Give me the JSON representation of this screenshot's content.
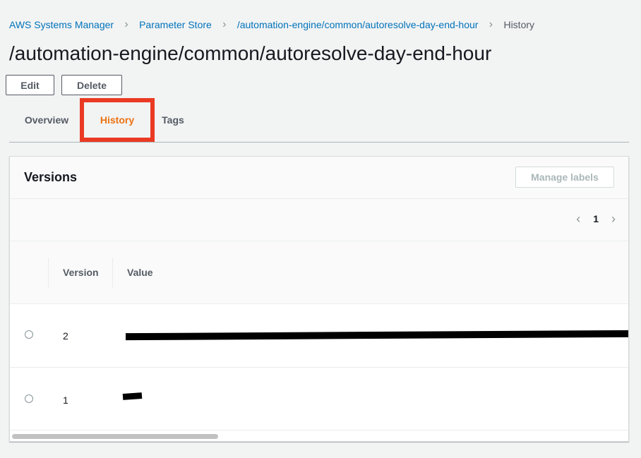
{
  "breadcrumb": {
    "items": [
      {
        "label": "AWS Systems Manager"
      },
      {
        "label": "Parameter Store"
      },
      {
        "label": "/automation-engine/common/autoresolve-day-end-hour"
      }
    ],
    "current": "History"
  },
  "page_title": "/automation-engine/common/autoresolve-day-end-hour",
  "actions": {
    "edit_label": "Edit",
    "delete_label": "Delete"
  },
  "tabs": [
    {
      "label": "Overview",
      "active": false
    },
    {
      "label": "History",
      "active": true
    },
    {
      "label": "Tags",
      "active": false
    }
  ],
  "versions_panel": {
    "title": "Versions",
    "manage_labels_label": "Manage labels",
    "pagination": {
      "current_page": "1",
      "prev_icon": "chevron-left-icon",
      "next_icon": "chevron-right-icon"
    },
    "columns": [
      "Version",
      "Value"
    ],
    "rows": [
      {
        "version": "2",
        "value_redacted": true
      },
      {
        "version": "1",
        "value_redacted": true
      }
    ]
  },
  "colors": {
    "link": "#0073bb",
    "active_tab": "#ec7211",
    "highlight_box": "#ea3a24",
    "background": "#f2f3f3"
  }
}
